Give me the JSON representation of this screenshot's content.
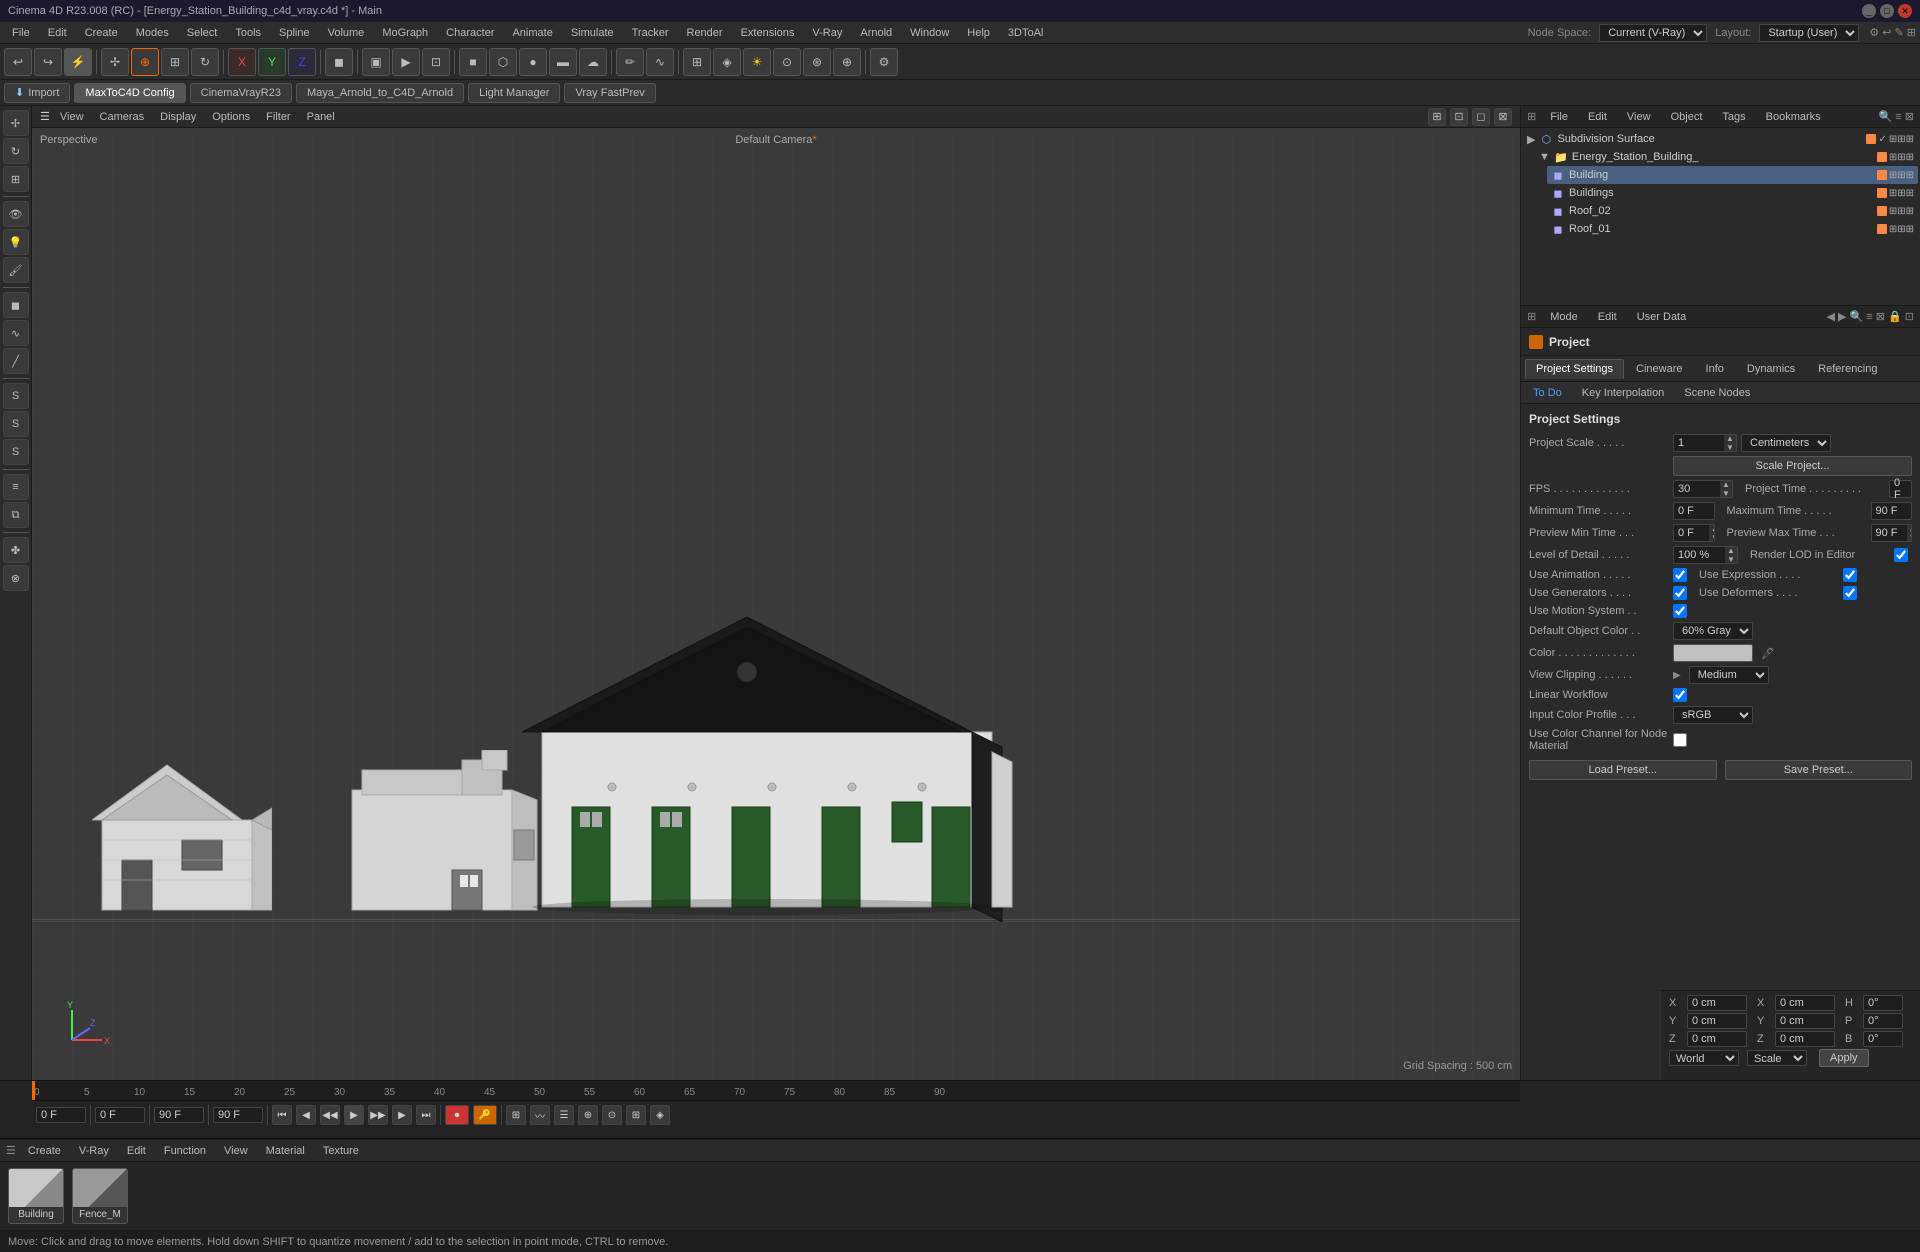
{
  "app": {
    "title": "Cinema 4D R23.008 (RC) - [Energy_Station_Building_c4d_vray.c4d *] - Main",
    "node_space": "Current (V-Ray)",
    "layout": "Startup (User)"
  },
  "menu_bar": {
    "items": [
      "File",
      "Edit",
      "Create",
      "Modes",
      "Select",
      "Tools",
      "Spline",
      "Volume",
      "MoGraph",
      "Character",
      "Animate",
      "Simulate",
      "Tracker",
      "Render",
      "Extensions",
      "V-Ray",
      "Arnold",
      "Window",
      "Help",
      "3DToAl"
    ]
  },
  "toolbar_tabs": {
    "items": [
      "Import",
      "MaxToC4D Config",
      "CinemaVrayR23",
      "Maya_Arnold_to_C4D_Arnold",
      "Light Manager",
      "Vray FastPrev"
    ]
  },
  "viewport": {
    "mode": "Perspective",
    "camera": "Default Camera",
    "menu_items": [
      "View",
      "Cameras",
      "Display",
      "Options",
      "Filter",
      "Panel"
    ],
    "grid_spacing": "Grid Spacing : 500 cm"
  },
  "object_manager": {
    "menu_items": [
      "File",
      "Edit",
      "View",
      "Object",
      "Tags",
      "Bookmarks"
    ],
    "objects": [
      {
        "name": "Subdivision Surface",
        "level": 0,
        "icon": "subdiv",
        "color": "#ff8844"
      },
      {
        "name": "Energy_Station_Building_",
        "level": 1,
        "icon": "folder",
        "color": "#ff8844"
      },
      {
        "name": "Building",
        "level": 2,
        "icon": "object",
        "color": "#ff8844"
      },
      {
        "name": "Buildings",
        "level": 2,
        "icon": "object",
        "color": "#ff8844"
      },
      {
        "name": "Roof_02",
        "level": 2,
        "icon": "object",
        "color": "#ff8844"
      },
      {
        "name": "Roof_01",
        "level": 2,
        "icon": "object",
        "color": "#ff8844"
      }
    ]
  },
  "properties": {
    "header_items": [
      "Mode",
      "Edit",
      "User Data"
    ],
    "tabs": [
      "Project Settings",
      "Cineware",
      "Info",
      "Dynamics",
      "Referencing"
    ],
    "sub_tabs": [
      "To Do",
      "Key Interpolation",
      "Scene Nodes"
    ],
    "section_title": "Project Settings",
    "fields": {
      "project_scale_value": "1",
      "project_scale_unit": "Centimeters",
      "scale_project_btn": "Scale Project...",
      "fps": "30",
      "project_time": "0 F",
      "minimum_time": "0 F",
      "maximum_time": "90 F",
      "preview_min_time": "0 F",
      "preview_max_time": "90 F",
      "level_of_detail": "100 %",
      "render_lod_in_editor_label": "Render LOD in Editor",
      "use_animation_label": "Use Animation",
      "use_expression_label": "Use Expression",
      "use_generators_label": "Use Generators",
      "use_deformers_label": "Use Deformers",
      "use_motion_system_label": "Use Motion System",
      "default_object_color_label": "Default Object Color",
      "default_object_color_value": "60% Gray",
      "color_label": "Color",
      "view_clipping_label": "View Clipping",
      "view_clipping_value": "Medium",
      "linear_workflow_label": "Linear Workflow",
      "input_color_profile_label": "Input Color Profile",
      "input_color_profile_value": "sRGB",
      "use_color_channel_label": "Use Color Channel for Node Material",
      "load_preset_btn": "Load Preset...",
      "save_preset_btn": "Save Preset..."
    }
  },
  "timeline": {
    "frame_markers": [
      "0",
      "5",
      "10",
      "15",
      "20",
      "25",
      "30",
      "35",
      "40",
      "45",
      "50",
      "55",
      "60",
      "65",
      "70",
      "75",
      "80",
      "85",
      "90"
    ],
    "current_frame": "0 F",
    "fps_display": "0 F",
    "max_time": "90 F",
    "end_time": "90 F"
  },
  "materials": {
    "items": [
      {
        "name": "Building",
        "color_top": "#cccccc",
        "color_bot": "#aaaaaa"
      },
      {
        "name": "Fence_M",
        "color_top": "#888888",
        "color_bot": "#666666"
      }
    ]
  },
  "coords": {
    "x_pos": "0 cm",
    "y_pos": "0 cm",
    "z_pos": "0 cm",
    "x_size": "0 cm",
    "y_size": "0 cm",
    "z_size": "0 cm",
    "coord_system": "World",
    "transform_mode": "Scale",
    "apply_btn": "Apply"
  },
  "status_bar": {
    "message": "Move: Click and drag to move elements. Hold down SHIFT to quantize movement / add to the selection in point mode, CTRL to remove."
  },
  "icons": {
    "menu_toggle": "☰",
    "play": "▶",
    "pause": "⏸",
    "stop": "⏹",
    "rewind": "⏮",
    "forward": "⏭",
    "prev_frame": "◀",
    "next_frame": "▶",
    "record": "⏺",
    "checkbox_checked": "✓",
    "arrow_up": "▲",
    "arrow_down": "▼"
  }
}
